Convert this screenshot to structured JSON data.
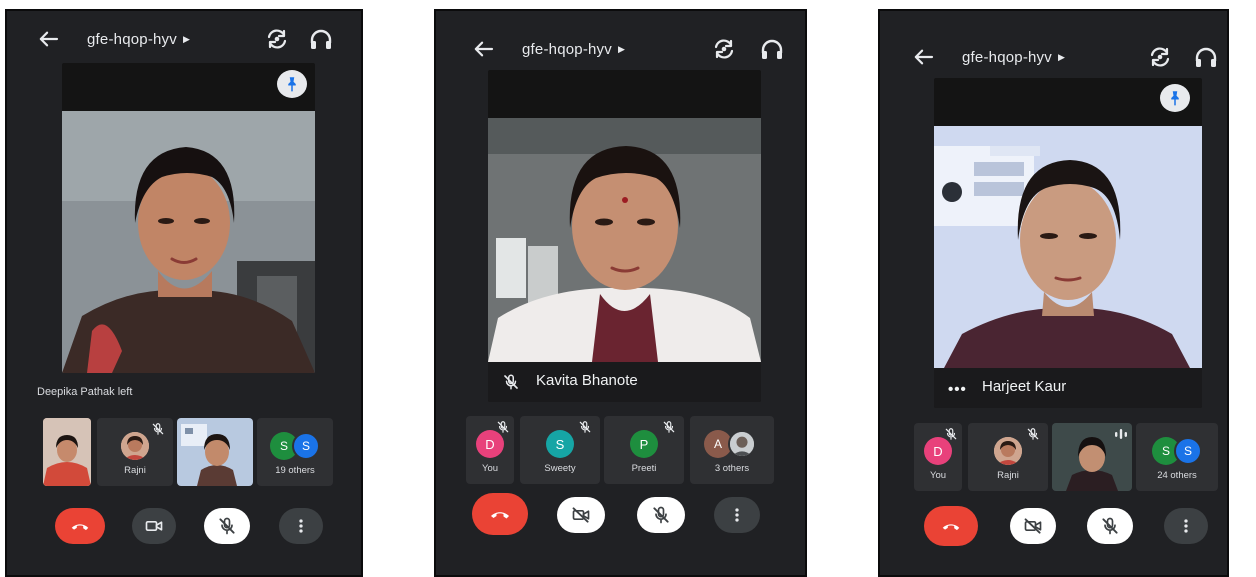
{
  "colors": {
    "app_background": "#202124",
    "hangup": "#ea4335",
    "avatar_pink": "#e8417b",
    "avatar_teal": "#16a5a5",
    "avatar_green": "#1e8e3e",
    "avatar_blue": "#1a73e8",
    "avatar_brown": "#8a5a4b"
  },
  "screens": [
    {
      "meeting_code": "gfe-hqop-hyv",
      "status_message": "Deepika Pathak left",
      "participants": [
        {
          "label": "",
          "kind": "video"
        },
        {
          "label": "Rajni",
          "kind": "photo"
        },
        {
          "label": "",
          "kind": "video"
        },
        {
          "label": "19 others",
          "avatars": [
            "S",
            "S"
          ]
        }
      ],
      "controls": [
        "hangup-icon",
        "camera-icon",
        "mic-off-icon",
        "more-vertical-icon"
      ]
    },
    {
      "meeting_code": "gfe-hqop-hyv",
      "speaker_name": "Kavita Bhanote",
      "participants": [
        {
          "label": "You",
          "avatar": "D"
        },
        {
          "label": "Sweety",
          "avatar": "S"
        },
        {
          "label": "Preeti",
          "avatar": "P"
        },
        {
          "label": "3 others",
          "avatars": [
            "A",
            ""
          ]
        }
      ],
      "controls": [
        "hangup-icon",
        "camera-off-icon",
        "mic-off-icon",
        "more-vertical-icon"
      ]
    },
    {
      "meeting_code": "gfe-hqop-hyv",
      "speaker_name": "Harjeet Kaur",
      "more_glyph": "•••",
      "participants": [
        {
          "label": "You",
          "avatar": "D"
        },
        {
          "label": "Rajni",
          "kind": "photo"
        },
        {
          "label": "",
          "kind": "video"
        },
        {
          "label": "24 others",
          "avatars": [
            "S",
            "S"
          ]
        }
      ],
      "controls": [
        "hangup-icon",
        "camera-off-icon",
        "mic-off-icon",
        "more-vertical-icon"
      ]
    }
  ]
}
